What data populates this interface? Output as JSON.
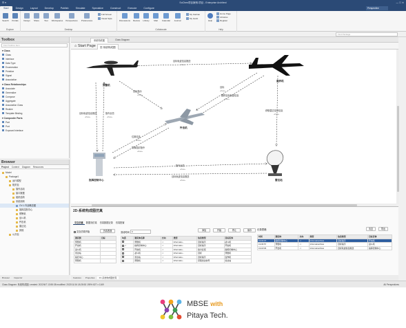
{
  "titlebar": {
    "title": "SoChen项目案例-项目 - Enterprise Architect"
  },
  "menu": {
    "items": [
      "Start",
      "Design",
      "Layout",
      "Develop",
      "Publish",
      "Simulate",
      "Specialize",
      "Construct",
      "Execute",
      "Configure"
    ],
    "active": "Start",
    "perspective": "Perspective"
  },
  "ribbon": {
    "groups": [
      {
        "label": "Explore",
        "buttons": [
          "Search",
          "Portals"
        ]
      },
      {
        "label": "Desktop",
        "buttons": [
          "Design",
          "Share",
          "Tour",
          "Workspaces",
          "Perspectives",
          "Preferences"
        ],
        "small": [
          "Full Screen",
          "Visual Style"
        ]
      },
      {
        "label": "Collaborate",
        "buttons": [
          "Discussions",
          "Review",
          "Library",
          "Mail",
          "Calendar",
          "Journal"
        ],
        "small": [
          "My Kanban",
          "My Gantt"
        ]
      },
      {
        "label": "Help",
        "buttons": [
          "Help"
        ],
        "small": [
          "Home Page",
          "Libraries",
          "Register"
        ]
      }
    ],
    "search_placeholder": "Find Package"
  },
  "toolbox": {
    "title": "Toolbox",
    "search_placeholder": "Find Toolbox Item",
    "sections": [
      {
        "title": "Class",
        "items": [
          "Class",
          "Interface",
          "Data Type",
          "Enumeration",
          "Primitive",
          "Signal",
          "Association"
        ]
      },
      {
        "title": "Class Relationships",
        "items": [
          "Associate",
          "Generalize",
          "Compose",
          "Aggregate",
          "Association Class",
          "Realize",
          "Template Binding"
        ]
      },
      {
        "title": "Composite Parts",
        "items": [
          "Part",
          "Port",
          "Exposed Interface"
        ]
      }
    ]
  },
  "browser": {
    "title": "Browser",
    "tabs": [
      "Project",
      "Context",
      "Diagram",
      "Resources"
    ],
    "items": [
      {
        "label": "Model",
        "level": 0,
        "kind": "pkg"
      },
      {
        "label": "Package1",
        "level": 1,
        "kind": "pkg"
      },
      {
        "label": "运行模型",
        "level": 2,
        "kind": "pkg"
      },
      {
        "label": "相关包",
        "level": 2,
        "kind": "pkg"
      },
      {
        "label": "操作活动",
        "level": 3,
        "kind": "pkg"
      },
      {
        "label": "接口数据",
        "level": 3,
        "kind": "pkg"
      },
      {
        "label": "组织结构",
        "level": 3,
        "kind": "pkg"
      },
      {
        "label": "系统用例",
        "level": 3,
        "kind": "pkg"
      },
      {
        "label": "OV-1 作战概念图",
        "level": 4,
        "kind": "diag"
      },
      {
        "label": "指挥控制中心",
        "level": 4,
        "kind": "pkg"
      },
      {
        "label": "预警机",
        "level": 4,
        "kind": "pkg"
      },
      {
        "label": "战斗机",
        "level": 4,
        "kind": "pkg"
      },
      {
        "label": "歼击机",
        "level": 4,
        "kind": "pkg"
      },
      {
        "label": "雷达站",
        "level": 4,
        "kind": "pkg"
      },
      {
        "label": "其他",
        "level": 4,
        "kind": "pkg"
      },
      {
        "label": "公共包",
        "level": 2,
        "kind": "pkg"
      }
    ],
    "bottom_tabs": [
      "Browser",
      "Inspector"
    ]
  },
  "doc_tabs": [
    "系统构成图",
    "Class Diagram"
  ],
  "page_tabs": {
    "start": "Start Page",
    "diagram": "系统构成图"
  },
  "diagram": {
    "nodes": [
      {
        "id": "awacs",
        "label": "预警机"
      },
      {
        "id": "bomber",
        "label": "轰炸机"
      },
      {
        "id": "fighter",
        "label": "歼击机"
      },
      {
        "id": "c2",
        "label": "指挥控制中心"
      },
      {
        "id": "radar",
        "label": "雷达站"
      }
    ],
    "edges": [
      {
        "label": "目标轨迹信息推送",
        "stereo": "«flow»"
      },
      {
        "label": "目标指示",
        "stereo": "«flow»"
      },
      {
        "label": "目标",
        "stereo": "«flow»"
      },
      {
        "label": "跟踪目标轨迹信息",
        "stereo": "«flow»"
      },
      {
        "label": "目标雷达信号",
        "stereo": "«flow»"
      },
      {
        "label": "指令反馈",
        "stereo": "«flow»"
      },
      {
        "label": "目标轨迹信息推送",
        "stereo": "«flow»"
      },
      {
        "label": "目标轨迹信息推送",
        "stereo": "«flow»"
      },
      {
        "label": "获取雷达信号信息",
        "stereo": "«flow»"
      },
      {
        "label": "位置信息",
        "stereo": "«flow»"
      },
      {
        "label": "导弹发射指令",
        "stereo": "«flow»"
      },
      {
        "label": "指令反馈",
        "stereo": "«flow»"
      },
      {
        "label": "目标轨迹信息推送",
        "stereo": "«flow»"
      }
    ]
  },
  "panel": {
    "title": "2D-系统构成图仿真",
    "tabs": [
      "交互仿真",
      "数据流仿真",
      "仿真数据记录",
      "仿真配置"
    ],
    "left_check": "交互仿真开始",
    "left_button": "仿真表观",
    "left_table": {
      "headers": [
        "源实例",
        "目标"
      ],
      "rows": [
        [
          "预警机",
          ""
        ],
        [
          "歼击机",
          ""
        ],
        [
          "战斗机",
          ""
        ],
        [
          "雷达站",
          ""
        ],
        [
          "指控中心",
          ""
        ],
        [
          "预警机",
          ""
        ]
      ]
    },
    "mid_label": "流动时间",
    "mid_value": "0",
    "mid_buttons": [
      "添加",
      "开始",
      "停止",
      "保存"
    ],
    "mid_table": {
      "headers": [
        "勾选",
        "源实体名称",
        "方向",
        "类型",
        "信息类型",
        "目标实体"
      ],
      "rows": [
        [
          "",
          "预警机",
          "->",
          "Informatio...",
          "目标指示",
          "战斗机"
        ],
        [
          "✓",
          "指挥控制中心",
          "->",
          "Informatio...",
          "目标指示",
          "歼击机"
        ],
        [
          "",
          "歼击机",
          "->",
          "Informatio...",
          "指令反馈",
          "指挥控制中心"
        ],
        [
          "",
          "战斗机",
          "->",
          "Informatio...",
          "目标",
          "预警机"
        ],
        [
          "",
          "雷达站",
          "->",
          "Informatio...",
          "目标指示",
          "轰炸机"
        ],
        [
          "",
          "预警机",
          "->",
          "Informatio...",
          "获取雷达信号",
          "雷达站"
        ]
      ]
    },
    "right_label": "记录表格",
    "right_buttons": [
      "清空",
      "导出"
    ],
    "right_table": {
      "headers": [
        "时间",
        "源实体",
        "方向",
        "类型",
        "信息类型",
        "目标实体"
      ],
      "rows": [
        [
          "19:04:07",
          "指挥控制中心",
          "->",
          "InformationFlow",
          "目标指示",
          "歼击机"
        ],
        [
          "19:06:57",
          "预警机",
          "->",
          "InformationFlow",
          "目标指示",
          "战斗机"
        ],
        [
          "19:18:06",
          "歼击机",
          "->",
          "InformationFlow",
          "目标轨迹信息推送",
          "指挥控制中心"
        ]
      ],
      "selected": 0
    },
    "bottom_tabs": [
      "Features",
      "Properties",
      "2D-系统构成图仿真"
    ]
  },
  "status": {
    "left": "Class Diagram: 系统构成图:  created: 2022/6/7 13:55:38  modified: 2022/11/16 18:28:53  195%  827 x 1169",
    "mid": "",
    "right": "All Perspectives"
  },
  "brand": {
    "title": "MBSE",
    "with": "with",
    "subtitle": "Pitaya Tech."
  },
  "colors": {
    "titlebar": "#2b4a76",
    "accent": "#2f5fa0",
    "brand_orange": "#e79a1f"
  }
}
